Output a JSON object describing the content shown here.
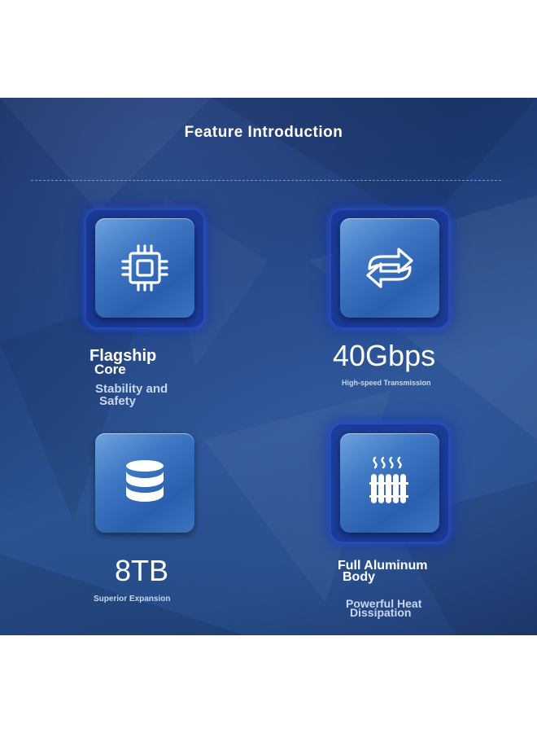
{
  "header": {
    "title": "Feature Introduction"
  },
  "features": [
    {
      "headline": "Flagship",
      "headline_line2": "Core",
      "sub": "Stability and",
      "sub_line2": "Safety",
      "icon": "chip-icon"
    },
    {
      "headline": "40Gbps",
      "sub": "High-speed Transmission",
      "icon": "swap-arrows-icon"
    },
    {
      "headline": "8TB",
      "sub": "Superior Expansion",
      "icon": "storage-stack-icon"
    },
    {
      "headline": "Full Aluminum",
      "headline_line2": "Body",
      "sub": "Powerful Heat",
      "sub_line2": "Dissipation",
      "icon": "heat-radiator-icon"
    }
  ],
  "colors": {
    "background": "#1e3f7a",
    "tile": "#3f78c4",
    "glow": "#1836a0",
    "text": "#ffffff"
  }
}
